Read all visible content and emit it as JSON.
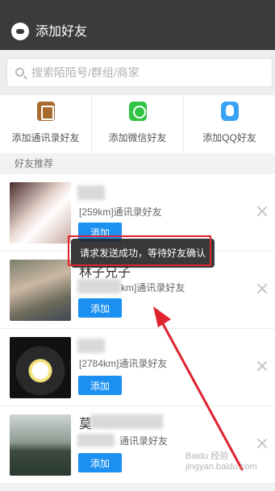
{
  "header": {
    "title": "添加好友"
  },
  "search": {
    "placeholder": "搜索陌陌号/群组/商家"
  },
  "quick_actions": [
    {
      "label": "添加通讯录好友",
      "icon": "contacts-book-icon"
    },
    {
      "label": "添加微信好友",
      "icon": "wechat-icon"
    },
    {
      "label": "添加QQ好友",
      "icon": "qq-icon"
    }
  ],
  "section": {
    "title": "好友推荐"
  },
  "recommendations": [
    {
      "name": "",
      "desc": "[259km]通讯录好友",
      "add_label": "添加"
    },
    {
      "name": "林子兄子",
      "desc": "km]通讯录好友",
      "add_label": "添加"
    },
    {
      "name": "",
      "desc": "[2784km]通讯录好友",
      "add_label": "添加"
    },
    {
      "name": "莫",
      "desc": "通讯录好友",
      "add_label": "添加"
    }
  ],
  "toast": {
    "message": "请求发送成功，等待好友确认"
  },
  "watermark": {
    "text": "Baidu 经验",
    "sub": "jingyan.baidu.com"
  },
  "colors": {
    "header_bg": "#3b3b3b",
    "add_button": "#1b90f0",
    "highlight": "#e0232e"
  }
}
